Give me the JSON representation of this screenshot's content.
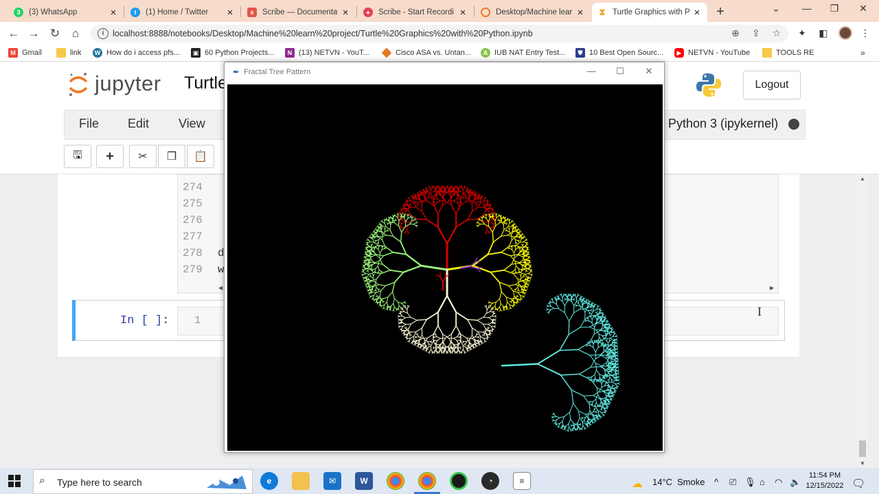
{
  "browser": {
    "tabs": [
      {
        "title": "(3) WhatsApp",
        "icon": "whatsapp-icon",
        "color": "#25d366"
      },
      {
        "title": "(1) Home / Twitter",
        "icon": "twitter-icon",
        "color": "#1d9bf0"
      },
      {
        "title": "Scribe — Documentati",
        "icon": "scribe-icon",
        "color": "#e2574c"
      },
      {
        "title": "Scribe - Start Recordi",
        "icon": "scribe-record-icon",
        "color": "#e34256"
      },
      {
        "title": "Desktop/Machine lear",
        "icon": "jupyter-tab-icon",
        "color": "#f37726"
      },
      {
        "title": "Turtle Graphics with P",
        "icon": "hourglass-icon",
        "color": "#f5a623"
      }
    ],
    "url": "localhost:8888/notebooks/Desktop/Machine%20learn%20project/Turtle%20Graphics%20with%20Python.ipynb",
    "bookmarks": [
      {
        "label": "Gmail",
        "icon": "gmail-icon",
        "color": "#ea4335"
      },
      {
        "label": "link",
        "icon": "folder-icon",
        "color": "#f7c948"
      },
      {
        "label": "How do i access pfs...",
        "icon": "wordpress-icon",
        "color": "#21759b"
      },
      {
        "label": "60 Python Projects...",
        "icon": "site-icon",
        "color": "#222222"
      },
      {
        "label": "(13) NETVN - YouT...",
        "icon": "netvn-icon",
        "color": "#8e2b8e"
      },
      {
        "label": "Cisco ASA vs. Untan...",
        "icon": "diamond-icon",
        "color": "#e07a1f"
      },
      {
        "label": "IUB NAT Entry Test...",
        "icon": "iub-icon",
        "color": "#8bc34a"
      },
      {
        "label": "10 Best Open Sourc...",
        "icon": "shield-bm-icon",
        "color": "#2c3e8f"
      },
      {
        "label": "NETVN - YouTube",
        "icon": "youtube-icon",
        "color": "#ff0000"
      },
      {
        "label": "TOOLS RE",
        "icon": "folder-icon",
        "color": "#f7c948"
      }
    ]
  },
  "jupyter": {
    "brand": "jupyter",
    "notebook_title": "Turtle",
    "logout": "Logout",
    "menu": [
      "File",
      "Edit",
      "View"
    ],
    "kernel": "Python 3 (ipykernel)",
    "code_lines": [
      {
        "num": "274",
        "text": ""
      },
      {
        "num": "275",
        "text": ""
      },
      {
        "num": "276",
        "text": ""
      },
      {
        "num": "277",
        "text": ""
      },
      {
        "num": "278",
        "text": "d"
      },
      {
        "num": "279",
        "text": "w"
      }
    ],
    "prompt": "In [ ]:",
    "cell_line": "1"
  },
  "turtle_window": {
    "title": "Fractal Tree Pattern",
    "background": "#000000",
    "tree_colors": {
      "red": "#d90000",
      "yellow": "#f2f20a",
      "light_green": "#9bf57a",
      "cream": "#f5f3d2",
      "cyan": "#5fe8e0",
      "purple": "#9b30d6"
    }
  },
  "taskbar": {
    "search_placeholder": "Type here to search",
    "weather": "14°C",
    "weather_text": "Smoke",
    "time": "11:54 PM",
    "date": "12/15/2022"
  }
}
